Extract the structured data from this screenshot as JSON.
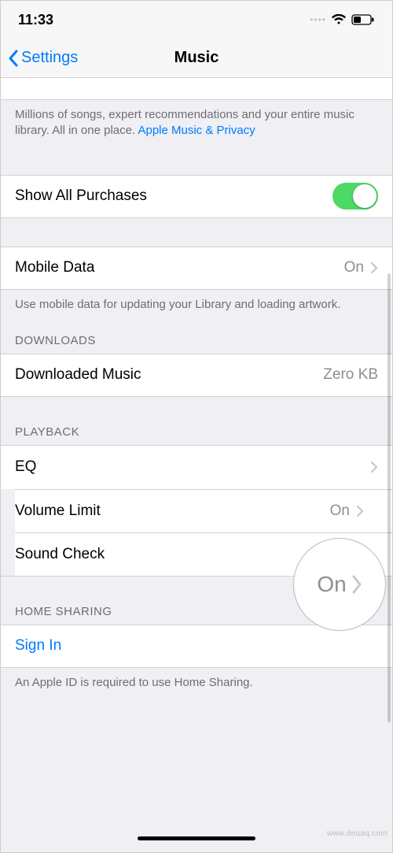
{
  "status": {
    "time": "11:33"
  },
  "nav": {
    "back": "Settings",
    "title": "Music"
  },
  "apple_music": {
    "footer_text": "Millions of songs, expert recommendations and your entire music library. All in one place. ",
    "footer_link": "Apple Music & Privacy"
  },
  "purchases": {
    "label": "Show All Purchases",
    "on": true
  },
  "mobile_data": {
    "label": "Mobile Data",
    "value": "On",
    "footer": "Use mobile data for updating your Library and loading artwork."
  },
  "downloads": {
    "header": "Downloads",
    "downloaded_label": "Downloaded Music",
    "downloaded_value": "Zero KB"
  },
  "playback": {
    "header": "Playback",
    "eq_label": "EQ",
    "volume_limit_label": "Volume Limit",
    "volume_limit_value": "On",
    "sound_check_label": "Sound Check",
    "sound_check_on": false
  },
  "home_sharing": {
    "header": "Home Sharing",
    "sign_in": "Sign In",
    "footer": "An Apple ID is required to use Home Sharing."
  },
  "magnifier": {
    "text": "On"
  },
  "watermark": "www.deuaq.com"
}
